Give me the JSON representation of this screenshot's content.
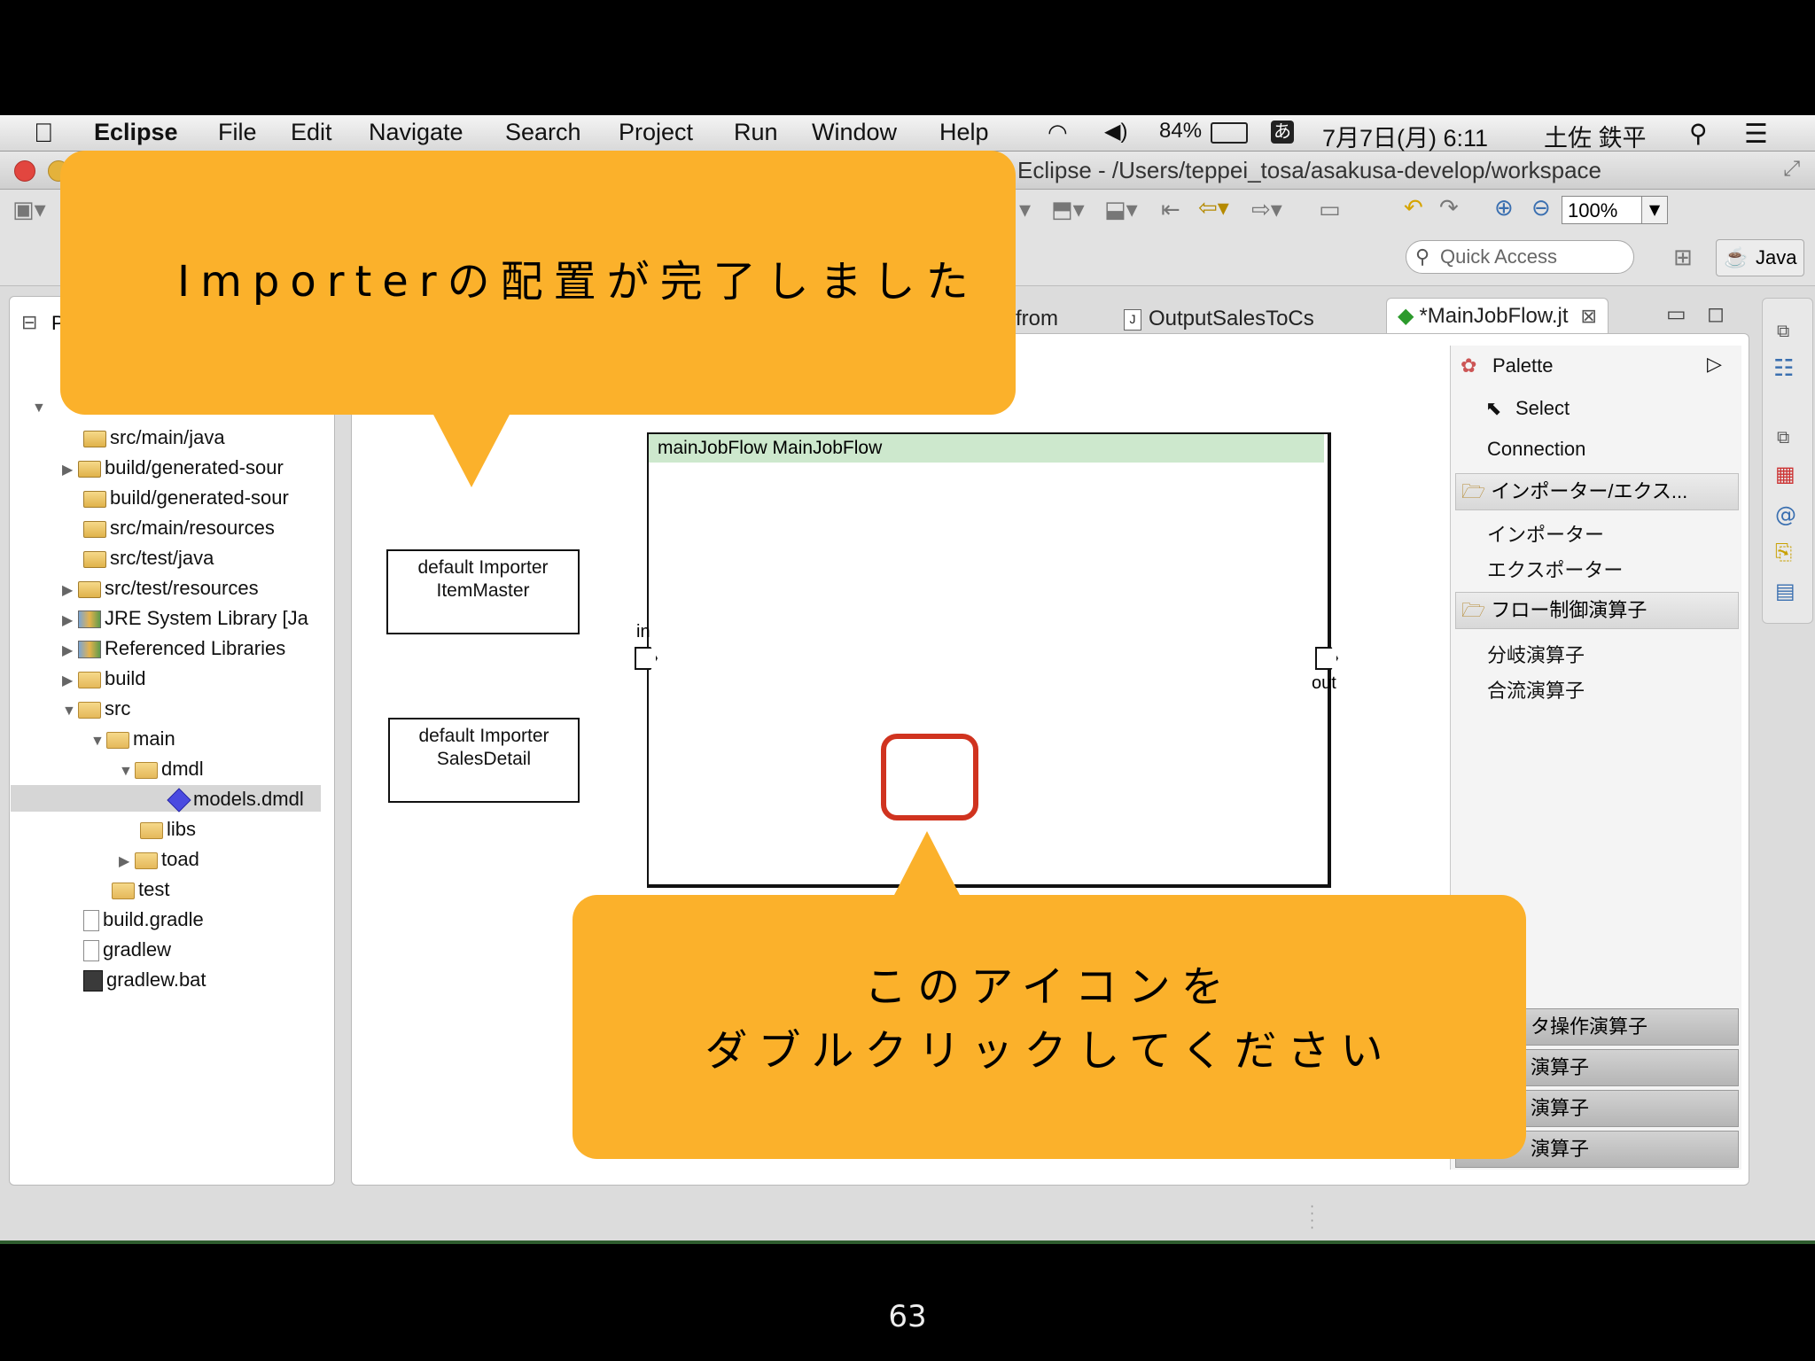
{
  "menubar": {
    "app": "Eclipse",
    "items": [
      "File",
      "Edit",
      "Navigate",
      "Search",
      "Project",
      "Run",
      "Window",
      "Help"
    ],
    "battery": "84%",
    "ime": "あ",
    "datetime": "7月7日(月) 6:11",
    "user": "土佐 鉄平"
  },
  "window": {
    "title": "Eclipse - /Users/teppei_tosa/asakusa-develop/workspace",
    "zoom": "100%",
    "quick_access_placeholder": "Quick Access",
    "perspective": "Java"
  },
  "package_explorer": {
    "tab_label": "P...",
    "items": [
      {
        "label": "src/main/java",
        "icon": "package-folder-icon"
      },
      {
        "label": "build/generated-sour",
        "icon": "package-folder-icon"
      },
      {
        "label": "build/generated-sour",
        "icon": "package-folder-icon"
      },
      {
        "label": "src/main/resources",
        "icon": "package-folder-icon"
      },
      {
        "label": "src/test/java",
        "icon": "package-folder-icon"
      },
      {
        "label": "src/test/resources",
        "icon": "package-folder-icon"
      },
      {
        "label": "JRE System Library [Ja",
        "icon": "library-icon"
      },
      {
        "label": "Referenced Libraries",
        "icon": "library-icon"
      },
      {
        "label": "build",
        "icon": "folder-icon"
      },
      {
        "label": "src",
        "icon": "folder-icon"
      },
      {
        "label": "main",
        "icon": "folder-icon"
      },
      {
        "label": "dmdl",
        "icon": "folder-icon"
      },
      {
        "label": "models.dmdl",
        "icon": "dmdl-file-icon"
      },
      {
        "label": "libs",
        "icon": "folder-icon"
      },
      {
        "label": "toad",
        "icon": "folder-icon"
      },
      {
        "label": "test",
        "icon": "folder-icon"
      },
      {
        "label": "build.gradle",
        "icon": "file-icon"
      },
      {
        "label": "gradlew",
        "icon": "file-icon"
      },
      {
        "label": "gradlew.bat",
        "icon": "batch-file-icon"
      }
    ]
  },
  "editor_tabs": {
    "tab_partial": "from",
    "tab_output": "OutputSalesToCs",
    "tab_active": "*MainJobFlow.jt"
  },
  "diagram": {
    "importer1_line1": "default Importer",
    "importer1_line2": "ItemMaster",
    "importer2_line1": "default Importer",
    "importer2_line2": "SalesDetail",
    "flow_header": "mainJobFlow MainJobFlow",
    "port_in": "in",
    "port_out": "out"
  },
  "palette": {
    "title": "Palette",
    "select": "Select",
    "connection": "Connection",
    "drawer1": "インポーター/エクス...",
    "importer": "インポーター",
    "exporter": "エクスポーター",
    "drawer2": "フロー制御演算子",
    "branch": "分岐演算子",
    "confluent": "合流演算子",
    "drawer3": "タ操作演算子",
    "drawer4": "演算子",
    "drawer5": "演算子",
    "drawer6": "演算子"
  },
  "callouts": {
    "top": "Importerの配置が完了しました",
    "bottom_line1": "このアイコンを",
    "bottom_line2": "ダブルクリックしてください"
  },
  "page_number": "63",
  "colors": {
    "callout": "#fbb12b",
    "highlight": "#d0331f",
    "flow_header": "#cde8cd"
  }
}
